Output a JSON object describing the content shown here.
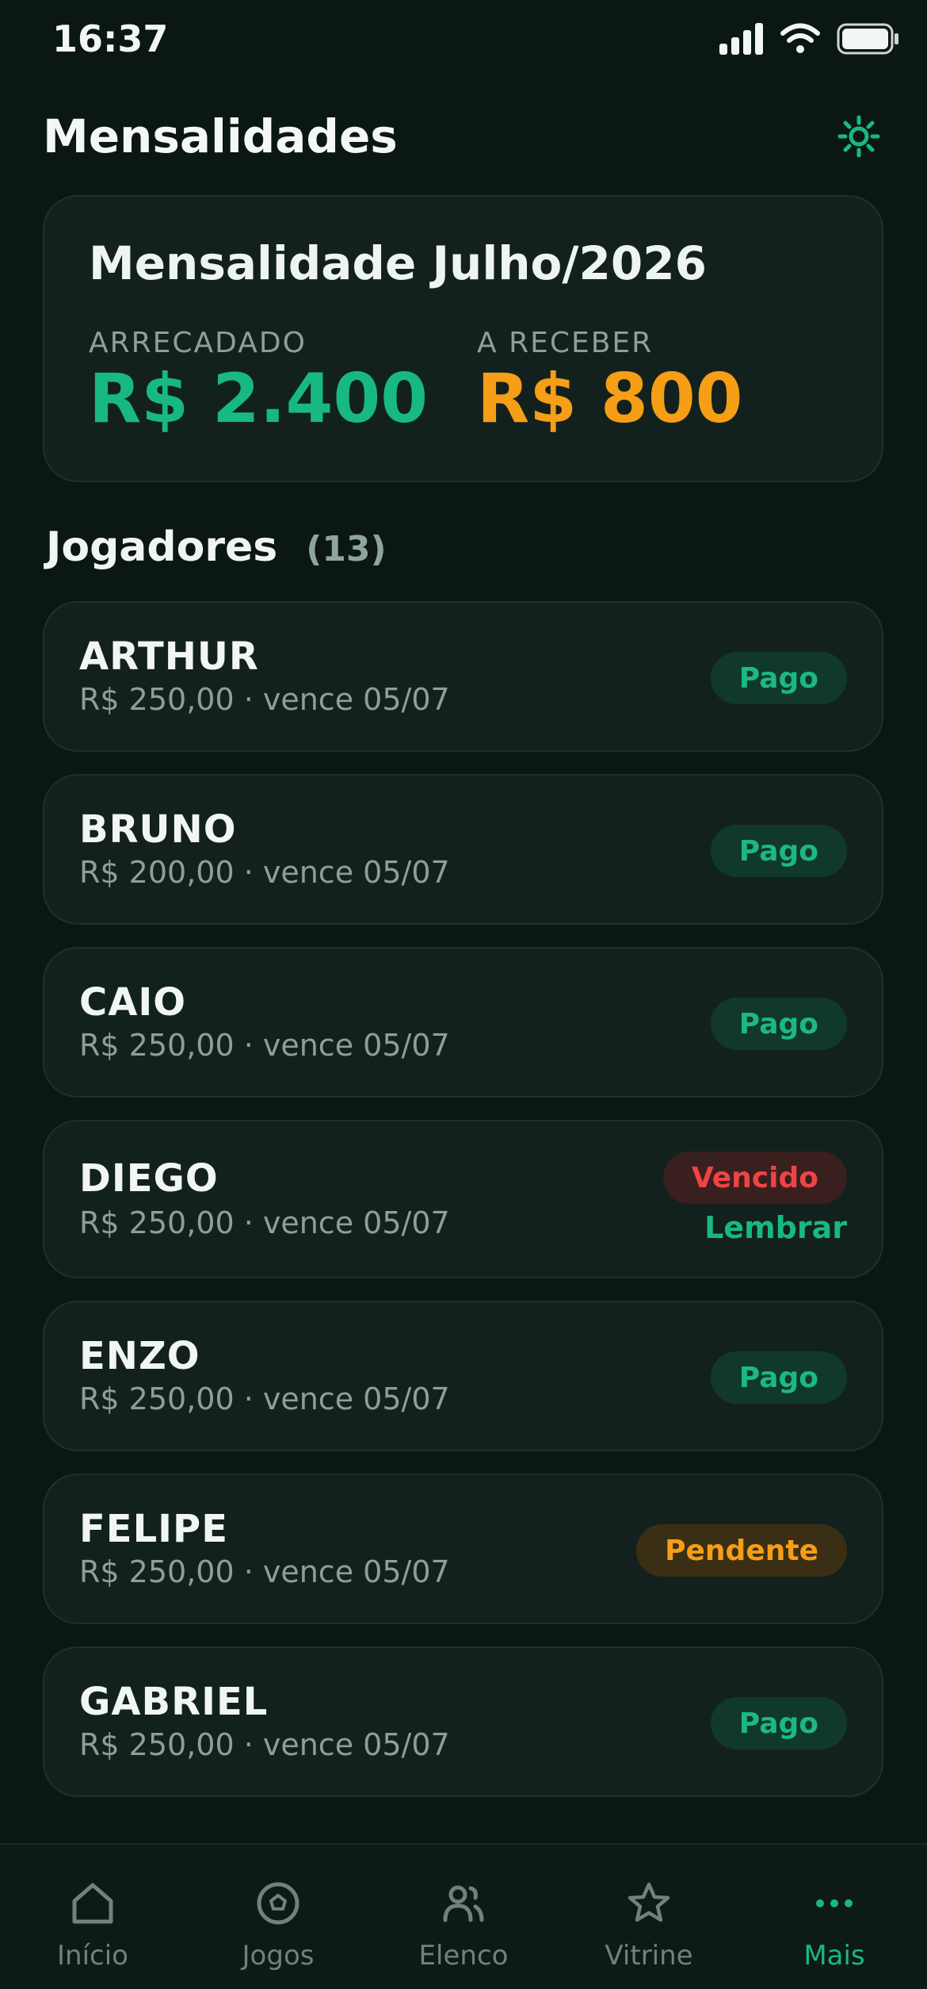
{
  "status_bar": {
    "time": "16:37"
  },
  "header": {
    "title": "Mensalidades"
  },
  "summary": {
    "title": "Mensalidade Julho/2026",
    "collected_label": "ARRECADADO",
    "collected_value": "R$ 2.400",
    "receivable_label": "A RECEBER",
    "receivable_value": "R$ 800"
  },
  "players_section": {
    "title": "Jogadores",
    "count": "(13)"
  },
  "players": [
    {
      "name": "ARTHUR",
      "meta": "R$ 250,00 · vence 05/07",
      "status": "Pago"
    },
    {
      "name": "BRUNO",
      "meta": "R$ 200,00 · vence 05/07",
      "status": "Pago"
    },
    {
      "name": "CAIO",
      "meta": "R$ 250,00 · vence 05/07",
      "status": "Pago"
    },
    {
      "name": "DIEGO",
      "meta": "R$ 250,00 · vence 05/07",
      "status": "Vencido",
      "action": "Lembrar"
    },
    {
      "name": "ENZO",
      "meta": "R$ 250,00 · vence 05/07",
      "status": "Pago"
    },
    {
      "name": "FELIPE",
      "meta": "R$ 250,00 · vence 05/07",
      "status": "Pendente"
    },
    {
      "name": "GABRIEL",
      "meta": "R$ 250,00 · vence 05/07",
      "status": "Pago"
    }
  ],
  "nav": {
    "items": [
      {
        "label": "Início",
        "icon": "home-icon"
      },
      {
        "label": "Jogos",
        "icon": "ball-icon"
      },
      {
        "label": "Elenco",
        "icon": "users-icon"
      },
      {
        "label": "Vitrine",
        "icon": "star-icon"
      },
      {
        "label": "Mais",
        "icon": "more-icon",
        "active": true
      }
    ]
  },
  "colors": {
    "accent": "#18b884",
    "warning": "#f59e16",
    "danger": "#ef4444",
    "background": "#0b1715",
    "card": "#13211e"
  }
}
